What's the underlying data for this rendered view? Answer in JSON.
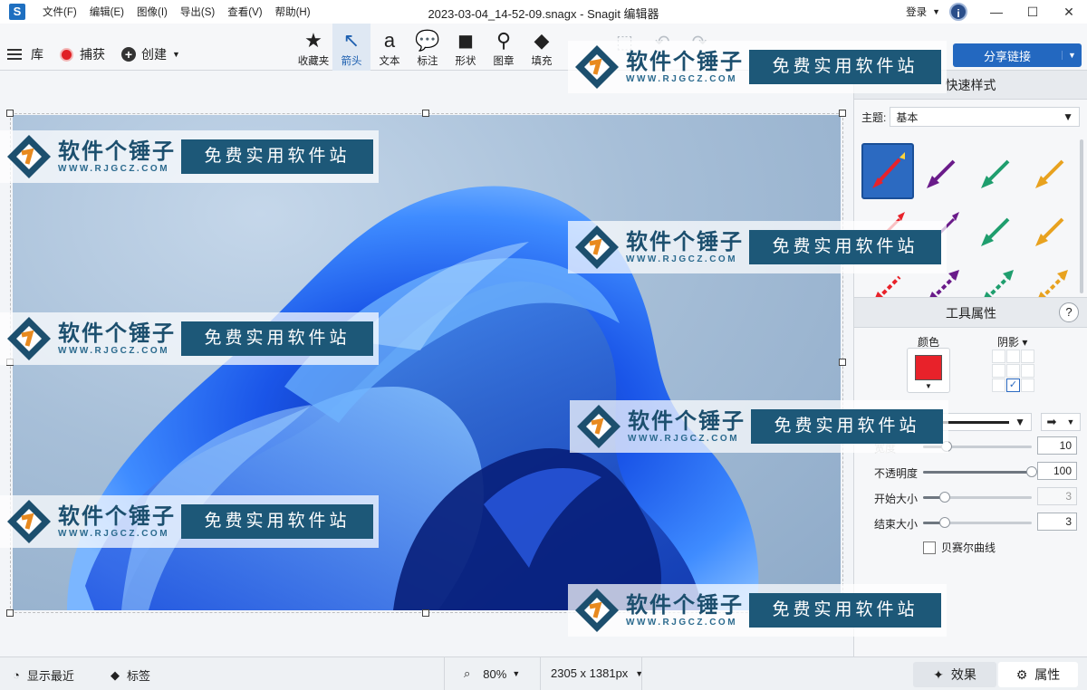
{
  "titlebar": {
    "app_icon": "S",
    "menu": [
      "文件(F)",
      "编辑(E)",
      "图像(I)",
      "导出(S)",
      "查看(V)",
      "帮助(H)"
    ],
    "title": "2023-03-04_14-52-09.snagx - Snagit 编辑器",
    "login": "登录",
    "info_icon": "i"
  },
  "toolbar": {
    "library": "库",
    "capture": "捕获",
    "create": "创建",
    "tools": [
      {
        "label": "收藏夹",
        "icon": "★"
      },
      {
        "label": "箭头",
        "icon": "↖"
      },
      {
        "label": "文本",
        "icon": "a"
      },
      {
        "label": "标注",
        "icon": "💬"
      },
      {
        "label": "形状",
        "icon": "◼"
      },
      {
        "label": "图章",
        "icon": "⚲"
      },
      {
        "label": "填充",
        "icon": "◆"
      }
    ],
    "active_tool": "箭头",
    "share": "分享链接"
  },
  "panel": {
    "quick_styles": "快速样式",
    "theme_label": "主题:",
    "theme_value": "基本",
    "tool_properties": "工具属性",
    "color_label": "颜色",
    "shadow_label": "阴影",
    "color_value": "#e8222a",
    "width_label": "宽度",
    "width_value": "10",
    "opacity_label": "不透明度",
    "opacity_value": "100",
    "start_size_label": "开始大小",
    "start_size_value": "3",
    "end_size_label": "结束大小",
    "end_size_value": "3",
    "bezier_label": "贝赛尔曲线",
    "style_colors": [
      "#e8222a",
      "#6a1b8a",
      "#1f9e6e",
      "#e8a21f",
      "#e8222a",
      "#6a1b8a",
      "#1f9e6e",
      "#e8a21f",
      "#e8222a",
      "#6a1b8a",
      "#1f9e6e",
      "#e8a21f"
    ]
  },
  "statusbar": {
    "recent": "显示最近",
    "tags": "标签",
    "zoom": "80%",
    "dimensions": "2305 x 1381px",
    "effects": "效果",
    "properties": "属性"
  },
  "watermark": {
    "brand": "软件个锤子",
    "url": "WWW.RJGCZ.COM",
    "slogan": "免费实用软件站"
  }
}
